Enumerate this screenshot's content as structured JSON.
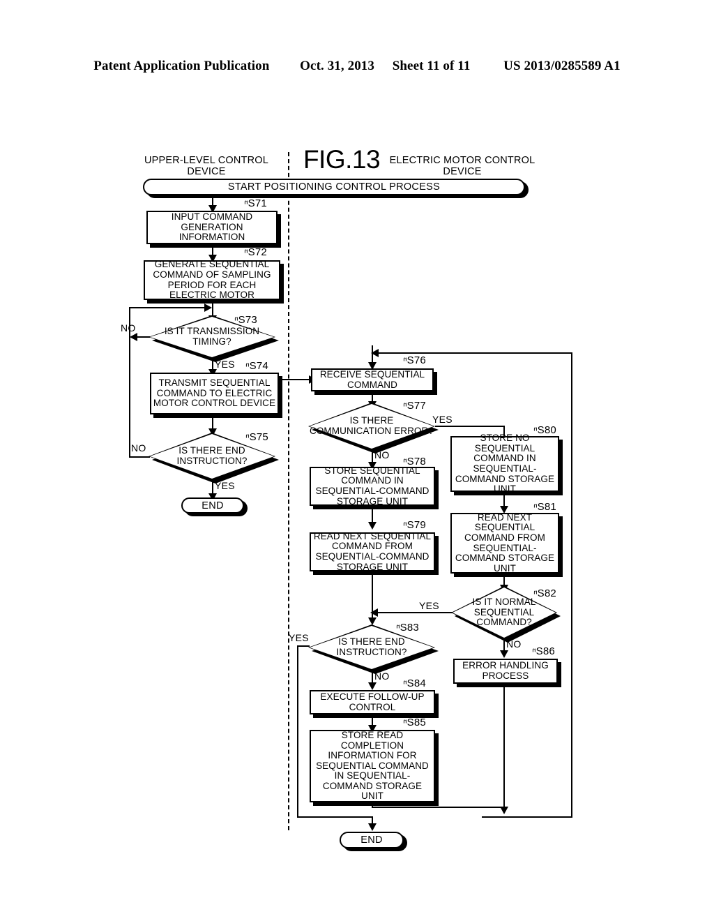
{
  "header": {
    "publication": "Patent Application Publication",
    "date": "Oct. 31, 2013",
    "sheet": "Sheet 11 of 11",
    "patent_number": "US 2013/0285589 A1"
  },
  "figure": {
    "title": "FIG.13",
    "lane_left": "UPPER-LEVEL CONTROL DEVICE",
    "lane_right": "ELECTRIC MOTOR CONTROL DEVICE",
    "start_terminator": "START POSITIONING CONTROL PROCESS",
    "end_left": "END",
    "end_right": "END"
  },
  "steps": {
    "s71": {
      "tag": "S71",
      "text": "INPUT COMMAND GENERATION INFORMATION"
    },
    "s72": {
      "tag": "S72",
      "text": "GENERATE SEQUENTIAL COMMAND OF SAMPLING PERIOD FOR EACH ELECTRIC MOTOR"
    },
    "s73": {
      "tag": "S73",
      "text": "IS IT TRANSMISSION TIMING?"
    },
    "s74": {
      "tag": "S74",
      "text": "TRANSMIT SEQUENTIAL COMMAND TO ELECTRIC MOTOR CONTROL DEVICE"
    },
    "s75": {
      "tag": "S75",
      "text": "IS THERE END INSTRUCTION?"
    },
    "s76": {
      "tag": "S76",
      "text": "RECEIVE SEQUENTIAL COMMAND"
    },
    "s77": {
      "tag": "S77",
      "text": "IS THERE COMMUNICATION ERROR?"
    },
    "s78": {
      "tag": "S78",
      "text": "STORE SEQUENTIAL COMMAND IN SEQUENTIAL-COMMAND STORAGE UNIT"
    },
    "s79": {
      "tag": "S79",
      "text": "READ NEXT SEQUENTIAL COMMAND FROM SEQUENTIAL-COMMAND STORAGE UNIT"
    },
    "s80": {
      "tag": "S80",
      "text": "STORE NO SEQUENTIAL COMMAND IN SEQUENTIAL-COMMAND STORAGE UNIT"
    },
    "s81": {
      "tag": "S81",
      "text": "READ NEXT SEQUENTIAL COMMAND FROM SEQUENTIAL-COMMAND STORAGE UNIT"
    },
    "s82": {
      "tag": "S82",
      "text": "IS IT NORMAL SEQUENTIAL COMMAND?"
    },
    "s83": {
      "tag": "S83",
      "text": "IS THERE END INSTRUCTION?"
    },
    "s84": {
      "tag": "S84",
      "text": "EXECUTE FOLLOW-UP CONTROL"
    },
    "s85": {
      "tag": "S85",
      "text": "STORE READ COMPLETION INFORMATION FOR SEQUENTIAL COMMAND IN SEQUENTIAL-COMMAND STORAGE UNIT"
    },
    "s86": {
      "tag": "S86",
      "text": "ERROR HANDLING PROCESS"
    }
  },
  "edge_labels": {
    "s73_no": "NO",
    "s73_yes": "YES",
    "s75_no": "NO",
    "s75_yes": "YES",
    "s77_yes": "YES",
    "s77_no": "NO",
    "s82_yes": "YES",
    "s82_no": "NO",
    "s83_yes": "YES",
    "s83_no": "NO"
  },
  "colors": {
    "ink": "#000000",
    "paper": "#ffffff"
  }
}
